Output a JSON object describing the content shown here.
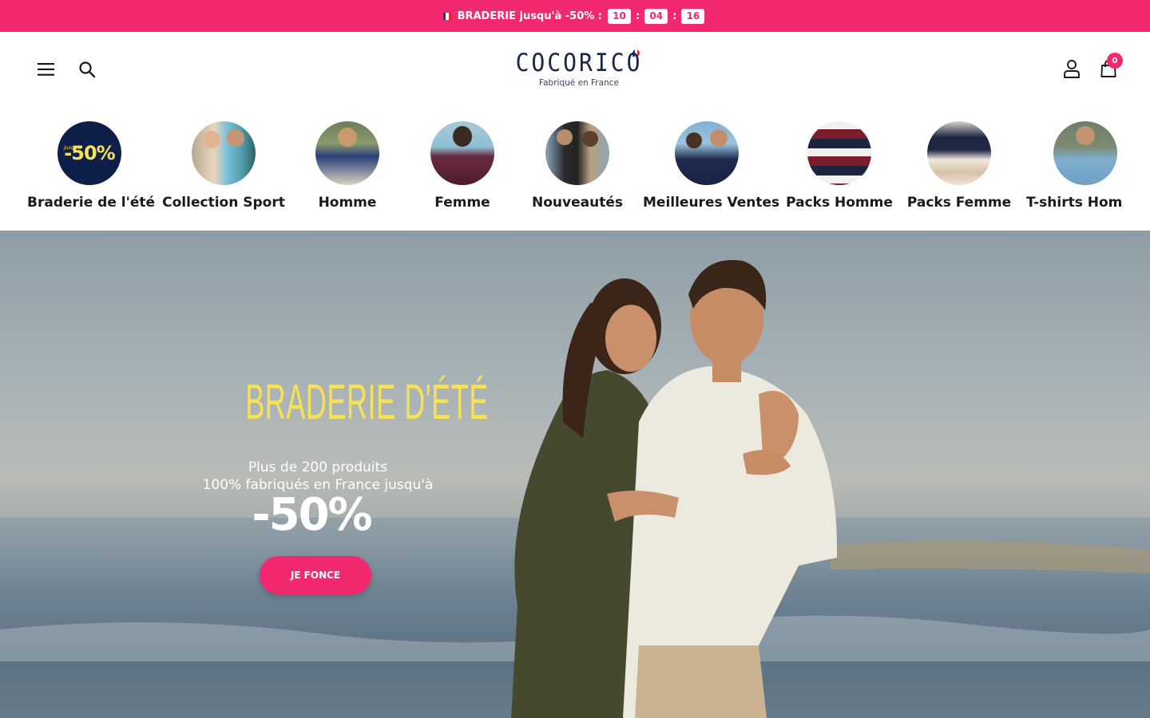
{
  "announcement": {
    "text": "BRADERIE jusqu'à -50% :",
    "countdown": [
      "10",
      "04",
      "16"
    ],
    "separator": ":",
    "flag_colors": [
      "#1d3b8f",
      "#ffffff",
      "#e6283b"
    ],
    "background": "#f2296f"
  },
  "header": {
    "menu_icon": "hamburger-icon",
    "search_icon": "search-icon",
    "account_icon": "user-icon",
    "cart_icon": "shopping-bag-icon",
    "logo": {
      "name": "COCORICO",
      "tagline": "Fabriqué en France"
    },
    "cart_count": "0"
  },
  "categories": [
    {
      "label": "Braderie de l'été",
      "badge": {
        "small": "jusqu'à",
        "big": "-50%"
      }
    },
    {
      "label": "Collection Sport"
    },
    {
      "label": "Homme"
    },
    {
      "label": "Femme"
    },
    {
      "label": "Nouveautés"
    },
    {
      "label": "Meilleures Ventes"
    },
    {
      "label": "Packs Homme"
    },
    {
      "label": "Packs Femme"
    },
    {
      "label": "T-shirts Hom"
    }
  ],
  "hero": {
    "title": "BRADERIE D'ÉTÉ",
    "subtitle_line1": "Plus de 200 produits",
    "subtitle_line2": "100% fabriqués en France jusqu'à",
    "discount": "-50%",
    "cta": "JE FONCE"
  },
  "colors": {
    "accent": "#f2296f",
    "navy": "#1b2545",
    "hero_title": "#f6e15a"
  }
}
